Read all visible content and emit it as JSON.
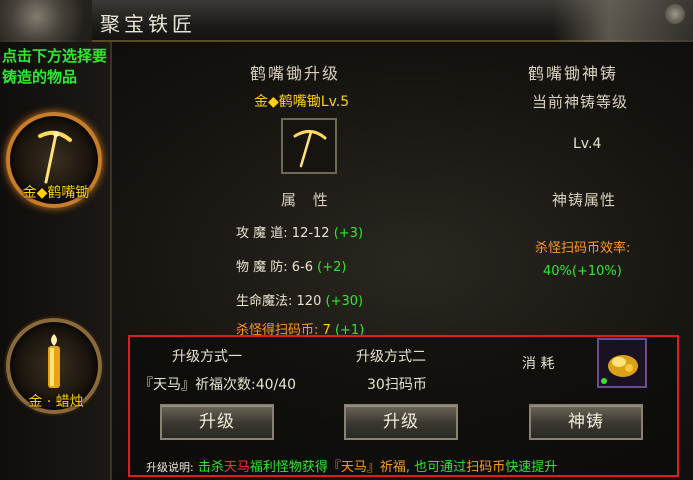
{
  "window": {
    "title": "聚宝铁匠"
  },
  "sidebar": {
    "hint": "点击下方选择要铸造的物品",
    "items": [
      {
        "label": "金◆鹤嘴锄",
        "icon": "pickaxe-icon",
        "selected": true
      },
      {
        "label": "金 · 蜡烛",
        "icon": "candle-icon",
        "selected": false
      }
    ]
  },
  "upgrade": {
    "header": "鹤嘴锄升级",
    "item_name": "金◆鹤嘴锄Lv.5",
    "attr_header": "属   性",
    "stats": [
      {
        "label": "攻 魔 道:",
        "value": "12-12",
        "bonus": "(+3)"
      },
      {
        "label": "物 魔 防:",
        "value": "6-6",
        "bonus": "(+2)"
      },
      {
        "label": "生命魔法:",
        "value": "120",
        "bonus": "(+30)"
      },
      {
        "label": "杀怪得扫码币:",
        "value": "7",
        "bonus": "(+1)"
      }
    ]
  },
  "divine": {
    "header": "鹤嘴锄神铸",
    "level_label": "当前神铸等级",
    "level": "Lv.4",
    "attr_header": "神铸属性",
    "stat_label": "杀怪扫码币效率:",
    "stat_value": "40%(+10%)"
  },
  "bottom": {
    "method1_label": "升级方式一",
    "method1_value": "『天马』祈福次数:40/40",
    "method2_label": "升级方式二",
    "method2_value": "30扫码币",
    "consume_label": "消   耗",
    "btn_upgrade1": "升级",
    "btn_upgrade2": "升级",
    "btn_divine": "神铸",
    "note": {
      "prefix": "升级说明:",
      "p1": "击杀",
      "p2": "天马",
      "p3": "福利怪物获得",
      "p4": "『天马』祈福",
      "p5": ", 也可通过",
      "p6": "扫码币",
      "p7": "快速提升"
    }
  },
  "colors": {
    "accent_green": "#2ee82e",
    "accent_yellow": "#ffd200",
    "accent_orange": "#ff9a1f",
    "border_red": "#e21b1b"
  }
}
